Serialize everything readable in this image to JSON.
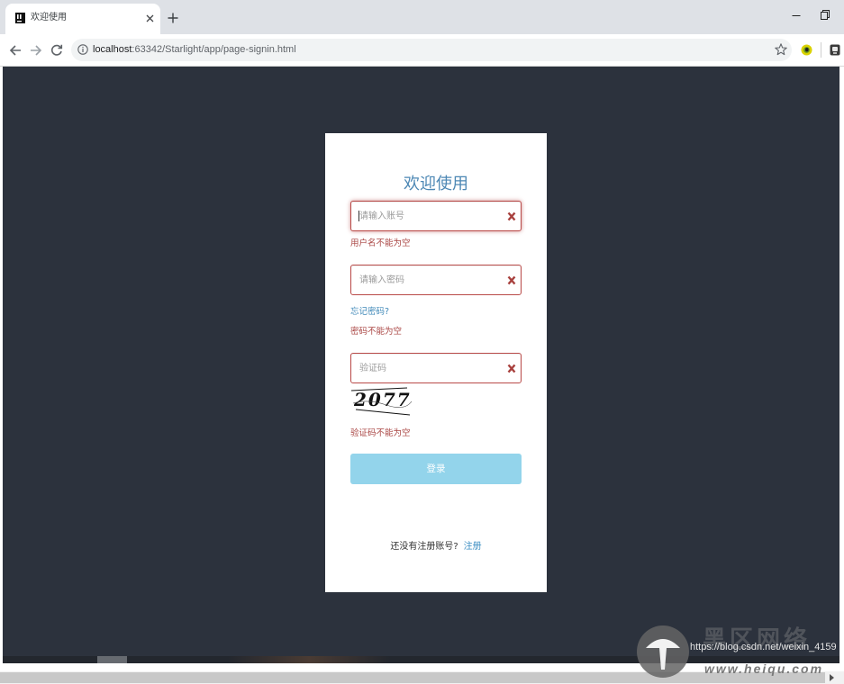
{
  "browser": {
    "tab": {
      "title": "欢迎使用",
      "favicon": "jetbrains-icon",
      "close_icon": "close-icon"
    },
    "new_tab_icon": "plus-icon",
    "window_controls": {
      "minimize_icon": "minimize-icon",
      "restore_icon": "restore-icon"
    },
    "nav": {
      "back_icon": "arrow-left-icon",
      "forward_icon": "arrow-right-icon",
      "reload_icon": "reload-icon"
    },
    "address_bar": {
      "site_info_icon": "info-icon",
      "url_host": "localhost",
      "url_path": ":63342/Starlight/app/page-signin.html",
      "bookmark_icon": "star-icon"
    },
    "extensions": [
      "yellow-extension-icon",
      "dark-extension-icon"
    ]
  },
  "signin": {
    "title": "欢迎使用",
    "username": {
      "placeholder": "请输入账号",
      "value": "",
      "error": "用户名不能为空",
      "status_icon": "error-x-icon"
    },
    "password": {
      "placeholder": "请输入密码",
      "value": "",
      "error": "密码不能为空",
      "status_icon": "error-x-icon"
    },
    "forgot_password": "忘记密码?",
    "captcha": {
      "placeholder": "验证码",
      "value": "",
      "code": "2077",
      "error": "验证码不能为空",
      "status_icon": "error-x-icon"
    },
    "submit_label": "登录",
    "register_prompt": "还没有注册账号?",
    "register_link": "注册"
  },
  "watermark": {
    "source_url": "https://blog.csdn.net/weixin_4159",
    "brand_name": "黑区网络",
    "brand_site": "www.heiqu.com",
    "logo_icon": "mushroom-logo-icon"
  },
  "colors": {
    "page_bg": "#2c323d",
    "title": "#4c87b4",
    "error_text": "#a94442",
    "error_border": "#b94a48",
    "button": "#93d4eb",
    "link": "#3f88b8"
  }
}
